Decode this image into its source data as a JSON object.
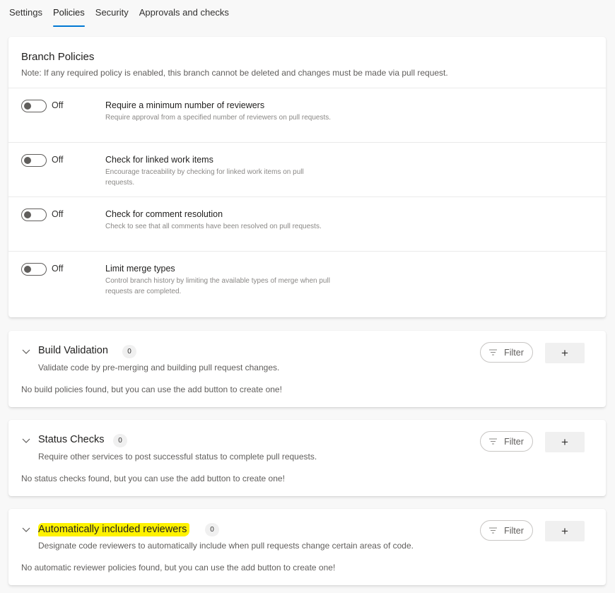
{
  "tabs": [
    {
      "label": "Settings",
      "active": false
    },
    {
      "label": "Policies",
      "active": true
    },
    {
      "label": "Security",
      "active": false
    },
    {
      "label": "Approvals and checks",
      "active": false
    }
  ],
  "colors": {
    "accent": "#0078d4",
    "highlight": "#fff200"
  },
  "branch_policies": {
    "title": "Branch Policies",
    "note": "Note: If any required policy is enabled, this branch cannot be deleted and changes must be made via pull request.",
    "policies": [
      {
        "toggle_state": "Off",
        "title": "Require a minimum number of reviewers",
        "description": "Require approval from a specified number of reviewers on pull requests."
      },
      {
        "toggle_state": "Off",
        "title": "Check for linked work items",
        "description": "Encourage traceability by checking for linked work items on pull requests."
      },
      {
        "toggle_state": "Off",
        "title": "Check for comment resolution",
        "description": "Check to see that all comments have been resolved on pull requests."
      },
      {
        "toggle_state": "Off",
        "title": "Limit merge types",
        "description": "Control branch history by limiting the available types of merge when pull requests are completed."
      }
    ]
  },
  "sections": [
    {
      "title": "Build Validation",
      "count": "0",
      "description": "Validate code by pre-merging and building pull request changes.",
      "empty_message": "No build policies found, but you can use the add button to create one!",
      "filter_label": "Filter",
      "add_label": "+",
      "highlighted": false
    },
    {
      "title": "Status Checks",
      "count": "0",
      "description": "Require other services to post successful status to complete pull requests.",
      "empty_message": "No status checks found, but you can use the add button to create one!",
      "filter_label": "Filter",
      "add_label": "+",
      "highlighted": false
    },
    {
      "title": "Automatically included reviewers",
      "count": "0",
      "description": "Designate code reviewers to automatically include when pull requests change certain areas of code.",
      "empty_message": "No automatic reviewer policies found, but you can use the add button to create one!",
      "filter_label": "Filter",
      "add_label": "+",
      "highlighted": true
    }
  ]
}
